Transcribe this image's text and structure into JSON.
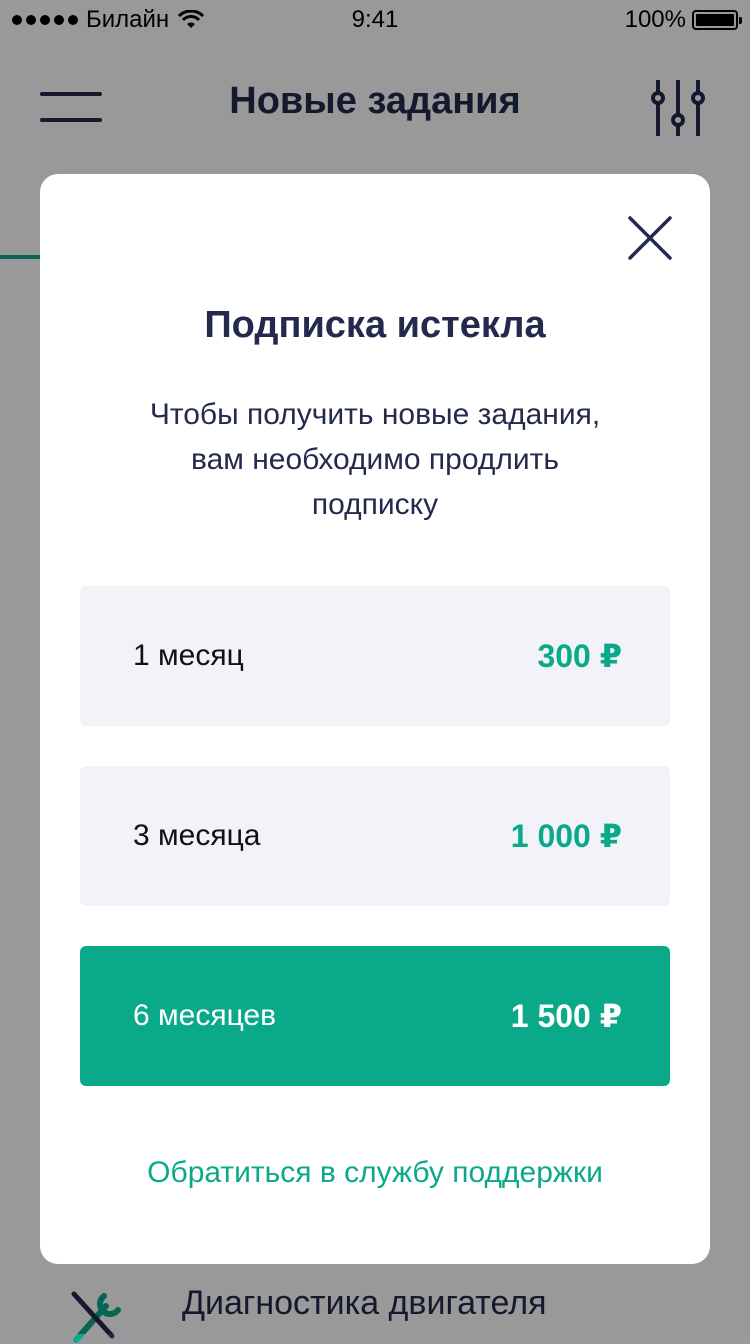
{
  "status_bar": {
    "carrier": "Билайн",
    "time": "9:41",
    "battery": "100%"
  },
  "header": {
    "title": "Новые задания",
    "menu_icon": "hamburger-menu-icon",
    "filter_icon": "sliders-filter-icon"
  },
  "background_list": {
    "items": [
      {
        "label": "Диагностика двигателя",
        "icon": "wrench-screwdriver-icon"
      }
    ]
  },
  "modal": {
    "title": "Подписка истекла",
    "description": "Чтобы получить новые задания, вам необходимо продлить подписку",
    "close_icon": "close-icon",
    "plans": [
      {
        "period": "1 месяц",
        "price": "300 ₽",
        "selected": false
      },
      {
        "period": "3 месяца",
        "price": "1 000 ₽",
        "selected": false
      },
      {
        "period": "6 месяцев",
        "price": "1 500 ₽",
        "selected": true
      }
    ],
    "support_link": "Обратиться в службу поддержки"
  },
  "colors": {
    "accent": "#0aa98a",
    "text_dark": "#232a4d",
    "plan_bg": "#f1f3f8",
    "overlay": "rgba(0,0,0,0.40)"
  }
}
